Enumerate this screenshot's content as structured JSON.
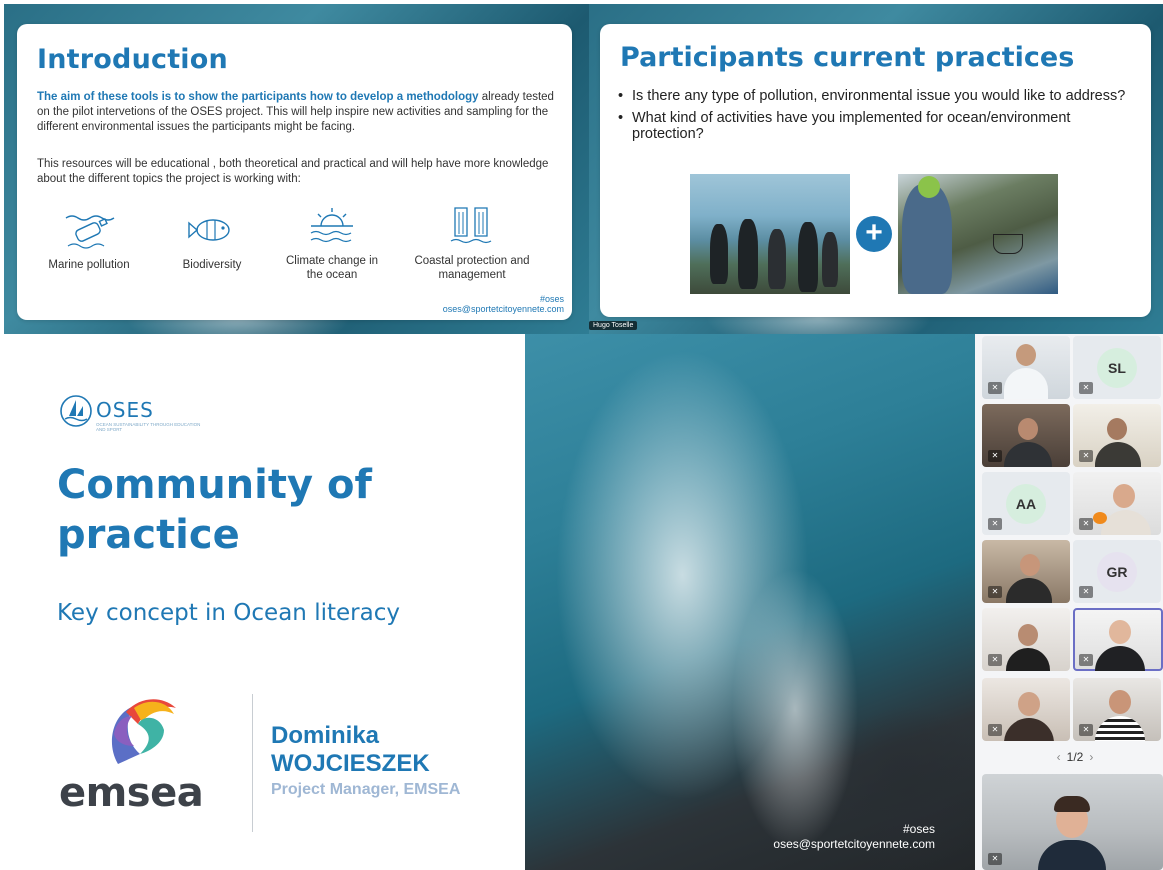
{
  "intro_slide": {
    "title": "Introduction",
    "p1_highlight": "The aim of these tools is to show the participants how to develop a methodology",
    "p1_rest": " already tested on the pilot intervetions of the OSES project. This will help inspire new activities and sampling for the different environmental issues the participants might be facing.",
    "p2": "This resources will be educational , both theoretical and practical and will help have more knowledge about the different topics the project is working with:",
    "topics": [
      {
        "label": "Marine pollution",
        "icon": "bottle-in-water-icon"
      },
      {
        "label": "Biodiversity",
        "icon": "fish-icon"
      },
      {
        "label": "Climate change in the ocean",
        "icon": "sun-over-waves-icon"
      },
      {
        "label": "Coastal protection and management",
        "icon": "waterfall-cliff-icon"
      }
    ],
    "footer_tag": "#oses",
    "footer_email": "oses@sportetcitoyennete.com"
  },
  "practice_slide": {
    "title": "Participants current practices",
    "bullets": [
      "Is there any type of pollution, environmental issue you would like to address?",
      "What kind of activities have you implemented for ocean/environment protection?"
    ],
    "plus_symbol": "+",
    "presenter_tag": "Hugo Toselle"
  },
  "cop_slide": {
    "oses_logo": "OSES",
    "oses_subtitle": "OCEAN SUSTAINABILITY THROUGH EDUCATION AND SPORT",
    "title": "Community of practice",
    "subtitle": "Key concept in Ocean literacy",
    "emsea_word": "emsea",
    "person_first": "Dominika",
    "person_last": "WOJCIESZEK",
    "person_role": "Project Manager, EMSEA"
  },
  "ocean_slide": {
    "tag": "#oses",
    "email": "oses@sportetcitoyennete.com"
  },
  "participants": {
    "initials": [
      "SL",
      "AA",
      "GR"
    ],
    "pager": "1/2",
    "pager_prev": "‹",
    "pager_next": "›"
  },
  "colors": {
    "brand_blue": "#1f78b4",
    "role_gray_blue": "#9fb7d4",
    "active_outline": "#6b6fc5"
  }
}
